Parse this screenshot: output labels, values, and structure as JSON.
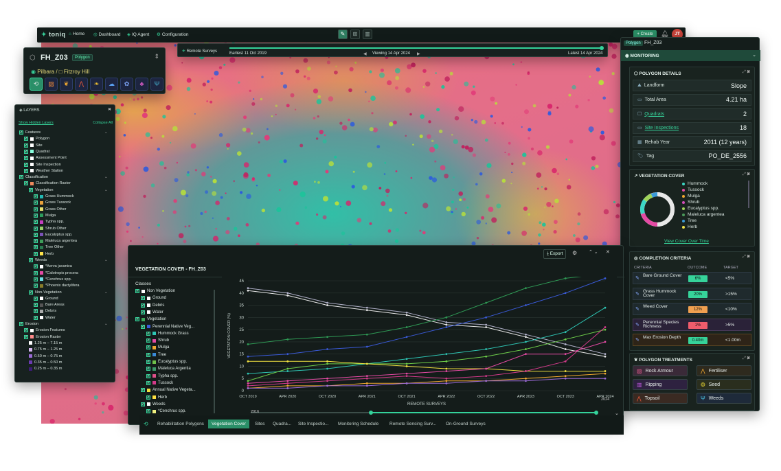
{
  "nav": {
    "logo": "toniq",
    "home": "Home",
    "dashboard": "Dashboard",
    "iq_agent": "IQ Agent",
    "configuration": "Configuration",
    "create": "+ Create",
    "avatar": "JT"
  },
  "timeline": {
    "remote_surveys": "Remote Surveys",
    "earliest": "Earliest 11 Oct 2019",
    "viewing": "Viewing 14 Apr 2024",
    "latest": "Latest 14 Apr 2024"
  },
  "polygon": {
    "name": "FH_Z03",
    "badge": "Polygon",
    "region": "Pilbara",
    "site": "Fitzroy Hill"
  },
  "layers": {
    "title": "LAYERS",
    "show_hidden": "Show Hidden Layers",
    "collapse_all": "Collapse All",
    "items": [
      {
        "label": "Features",
        "indent": 0,
        "sw": ""
      },
      {
        "label": "Polygon",
        "indent": 1,
        "sw": "#ffffff"
      },
      {
        "label": "Site",
        "indent": 1,
        "sw": "#ffffff"
      },
      {
        "label": "Quadrat",
        "indent": 1,
        "sw": "#8fd"
      },
      {
        "label": "Assessment Point",
        "indent": 1,
        "sw": "#fff"
      },
      {
        "label": "Site Inspection",
        "indent": 1,
        "sw": "#fff"
      },
      {
        "label": "Weather Station",
        "indent": 1,
        "sw": "#fff"
      },
      {
        "label": "Classification",
        "indent": 0,
        "sw": ""
      },
      {
        "label": "Classification Raster",
        "indent": 1,
        "sw": "#f08a5d"
      },
      {
        "label": "Vegetation",
        "indent": 2,
        "sw": ""
      },
      {
        "label": "Grass Hummock",
        "indent": 3,
        "sw": "#23b8b2"
      },
      {
        "label": "Grass Tussock",
        "indent": 3,
        "sw": "#e9a23b"
      },
      {
        "label": "Grass Other",
        "indent": 3,
        "sw": "#e6e070"
      },
      {
        "label": "Mulga",
        "indent": 3,
        "sw": "#2c9c5c"
      },
      {
        "label": "Typha spp.",
        "indent": 3,
        "sw": "#c53fbf"
      },
      {
        "label": "Shrub Other",
        "indent": 3,
        "sw": "#9ad06a"
      },
      {
        "label": "Eucalyptus spp.",
        "indent": 3,
        "sw": "#7b52b8"
      },
      {
        "label": "Maleluca argentea",
        "indent": 3,
        "sw": "#3f9e5a"
      },
      {
        "label": "Tree Other",
        "indent": 3,
        "sw": "#2a7c4f"
      },
      {
        "label": "Herb",
        "indent": 3,
        "sw": "#ffe34a"
      },
      {
        "label": "Weeds",
        "indent": 2,
        "sw": ""
      },
      {
        "label": "*Aerva javanica",
        "indent": 3,
        "sw": "#ffffff"
      },
      {
        "label": "*Calotropis procera",
        "indent": 3,
        "sw": "#e54aa4"
      },
      {
        "label": "*Cenchrus spp.",
        "indent": 3,
        "sw": "#6fe0e6"
      },
      {
        "label": "*Phoenix dactylifera",
        "indent": 3,
        "sw": "#8a7d2a"
      },
      {
        "label": "Non-Vegetation",
        "indent": 2,
        "sw": ""
      },
      {
        "label": "Ground",
        "indent": 3,
        "sw": "#ffffff"
      },
      {
        "label": "Bare Areas",
        "indent": 3,
        "sw": "#555"
      },
      {
        "label": "Debris",
        "indent": 3,
        "sw": "#aaaaaa"
      },
      {
        "label": "Water",
        "indent": 3,
        "sw": "#ffffff"
      },
      {
        "label": "Erosion",
        "indent": 0,
        "sw": ""
      },
      {
        "label": "Erosion Features",
        "indent": 1,
        "sw": "#ffffff"
      },
      {
        "label": "Erosion Raster",
        "indent": 1,
        "sw": "#ff8a8a"
      },
      {
        "label": "1.25 m – 7.15 m",
        "indent": 2,
        "sw": "#ffffff",
        "nocb": true
      },
      {
        "label": "0.75 m – 1.25 m",
        "indent": 2,
        "sw": "#d6b8f0",
        "nocb": true
      },
      {
        "label": "0.50 m – 0.75 m",
        "indent": 2,
        "sw": "#9a6ad6",
        "nocb": true
      },
      {
        "label": "0.35 m – 0.50 m",
        "indent": 2,
        "sw": "#6b3ab0",
        "nocb": true
      },
      {
        "label": "0.25 m – 0.35 m",
        "indent": 2,
        "sw": "#3c1b78",
        "nocb": true
      }
    ]
  },
  "right": {
    "tag": "Polygon",
    "name": "FH_Z03",
    "monitoring": "MONITORING",
    "details_title": "POLYGON DETAILS",
    "details": [
      {
        "k": "Landform",
        "v": "Slope",
        "link": false
      },
      {
        "k": "Total Area",
        "v": "4.21 ha",
        "link": false
      },
      {
        "k": "Quadrats",
        "v": "2",
        "link": true
      },
      {
        "k": "Site Inspections",
        "v": "18",
        "link": true
      },
      {
        "k": "Rehab Year",
        "v": "2011 (12 years)",
        "link": false
      },
      {
        "k": "Tag",
        "v": "PO_DE_2556",
        "link": false
      }
    ],
    "veg_title": "VEGETATION COVER",
    "veg_legend": [
      {
        "label": "Hummock",
        "color": "#3cd6c4"
      },
      {
        "label": "Tussock",
        "color": "#e54aa4"
      },
      {
        "label": "Mulga",
        "color": "#f0a830"
      },
      {
        "label": "Shrub",
        "color": "#d24db8"
      },
      {
        "label": "Eucalyptus spp.",
        "color": "#9fd45a"
      },
      {
        "label": "Maleluca argentea",
        "color": "#4a9a5a"
      },
      {
        "label": "Tree",
        "color": "#3a9ad8"
      },
      {
        "label": "Herb",
        "color": "#f0e04a"
      }
    ],
    "view_cover": "View Cover Over Time",
    "comp_title": "COMPLETION CRITERIA",
    "comp_headers": [
      "CRITERIA",
      "OUTCOME",
      "TARGET"
    ],
    "criteria": [
      {
        "name": "Bare Ground Cover",
        "outcome": "6%",
        "target": "<5%",
        "color": "#36d39a"
      },
      {
        "name": "Grass Hummock Cover",
        "outcome": "20%",
        "target": ">15%",
        "color": "#36d39a"
      },
      {
        "name": "Weed Cover",
        "outcome": "12%",
        "target": "<10%",
        "color": "#f0a050"
      },
      {
        "name": "Perennial Species Richness",
        "outcome": "1%",
        "target": ">5%",
        "color": "#ef5c6c"
      },
      {
        "name": "Max Erosion Depth",
        "outcome": "0.40m",
        "target": "<1.00m",
        "color": "#36d39a"
      }
    ],
    "treat_title": "POLYGON TREATMENTS",
    "treatments": [
      "Rock Armour",
      "Fertiliser",
      "Ripping",
      "Seed",
      "Topsoil",
      "Weeds"
    ]
  },
  "chart_panel": {
    "title": "VEGETATION COVER - FH_Z03",
    "export": "Export",
    "classes_title": "Classes",
    "classes": [
      {
        "label": "Non Vegetation",
        "indent": 0,
        "sw": "#ffffff"
      },
      {
        "label": "Ground",
        "indent": 1,
        "sw": "#ffffff"
      },
      {
        "label": "Debris",
        "indent": 1,
        "sw": "#ffffff"
      },
      {
        "label": "Water",
        "indent": 1,
        "sw": "#ffffff"
      },
      {
        "label": "Vegetation",
        "indent": 0,
        "sw": "#3ca65a"
      },
      {
        "label": "Perennial Native Veg...",
        "indent": 1,
        "sw": "#3a5ad8"
      },
      {
        "label": "Hummock Grass",
        "indent": 2,
        "sw": "#2ec5b4"
      },
      {
        "label": "Shrub",
        "indent": 2,
        "sw": "#e54aa4"
      },
      {
        "label": "Mulga",
        "indent": 2,
        "sw": "#f0a830"
      },
      {
        "label": "Tree",
        "indent": 2,
        "sw": "#3a8ad8"
      },
      {
        "label": "Eucalyptus spp.",
        "indent": 2,
        "sw": "#6fc04a"
      },
      {
        "label": "Maleluca Argentia",
        "indent": 2,
        "sw": "#3c9a6a"
      },
      {
        "label": "Typha spp.",
        "indent": 2,
        "sw": "#e0508a"
      },
      {
        "label": "Tussock",
        "indent": 2,
        "sw": "#d23a8a"
      },
      {
        "label": "Annual Native Vegeta...",
        "indent": 1,
        "sw": "#f0e040"
      },
      {
        "label": "Herb",
        "indent": 2,
        "sw": "#ffe040"
      },
      {
        "label": "Weeds",
        "indent": 1,
        "sw": "#ffffff"
      },
      {
        "label": "*Cenchrus spp.",
        "indent": 2,
        "sw": "#f0f080"
      }
    ],
    "range_start": "2016",
    "range_end": "2024"
  },
  "chart_data": {
    "type": "line",
    "ylabel": "VEGETATION COVER (%)",
    "xlabel": "REMOTE SURVEYS",
    "ylim": [
      0,
      45
    ],
    "yticks": [
      0,
      5,
      10,
      15,
      20,
      25,
      30,
      35,
      40,
      45
    ],
    "x": [
      "OCT 2019",
      "APR 2020",
      "OCT 2020",
      "APR 2021",
      "OCT 2021",
      "APR 2022",
      "OCT 2022",
      "APR 2023",
      "OCT 2023",
      "APR 2024"
    ],
    "series": [
      {
        "color": "#e8e8e8",
        "values": [
          41,
          39,
          35,
          33,
          31,
          27,
          26,
          22,
          17,
          14
        ]
      },
      {
        "color": "#b0b0c8",
        "values": [
          42,
          40,
          36,
          34,
          32,
          28,
          27,
          23,
          19,
          15
        ]
      },
      {
        "color": "#3a5ad8",
        "values": [
          14,
          15,
          17,
          18,
          22,
          26,
          30,
          35,
          40,
          46
        ]
      },
      {
        "color": "#2f9a55",
        "values": [
          19,
          21,
          22,
          23,
          26,
          30,
          36,
          42,
          46,
          48
        ]
      },
      {
        "color": "#2ec5b4",
        "values": [
          7,
          8,
          9,
          11,
          13,
          15,
          17,
          20,
          24,
          34
        ]
      },
      {
        "color": "#6fd04a",
        "values": [
          4,
          9,
          11,
          11,
          11,
          12,
          14,
          17,
          21,
          25
        ]
      },
      {
        "color": "#f0e040",
        "values": [
          12,
          12,
          12,
          11,
          10,
          9,
          9,
          8,
          8,
          8
        ]
      },
      {
        "color": "#e54aa4",
        "values": [
          3,
          4,
          5,
          6,
          7,
          8,
          9,
          15,
          15,
          20
        ]
      },
      {
        "color": "#d23a8a",
        "values": [
          2,
          3,
          4,
          5,
          6,
          5,
          6,
          8,
          12,
          26
        ]
      },
      {
        "color": "#f0a830",
        "values": [
          1,
          2,
          2,
          3,
          3,
          4,
          4,
          5,
          6,
          7
        ]
      },
      {
        "color": "#9a6ad6",
        "values": [
          1,
          1,
          2,
          2,
          3,
          3,
          4,
          4,
          5,
          5
        ]
      }
    ]
  },
  "tabs": [
    "Rehabilitation Polygons",
    "Vegetation Cover",
    "Sites",
    "Quadra...",
    "Site Inspectio...",
    "Monitoring Schedule",
    "Remote Sensing Surv...",
    "On-Ground Surveys"
  ]
}
